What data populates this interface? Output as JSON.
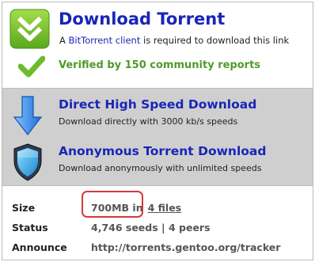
{
  "header": {
    "title": "Download Torrent",
    "subtitle_prefix": "A ",
    "client_link": "BitTorrent client",
    "subtitle_suffix": " is required to download this link",
    "verified": "Verified by 150 community reports"
  },
  "offers": [
    {
      "title": "Direct High Speed Download",
      "subtitle": "Download directly with 3000 kb/s speeds",
      "icon": "down-arrow-icon"
    },
    {
      "title": "Anonymous Torrent Download",
      "subtitle": "Download anonymously with unlimited speeds",
      "icon": "shield-icon"
    }
  ],
  "details": {
    "size_label": "Size",
    "size_value": "700MB in",
    "files_link": "4 files",
    "status_label": "Status",
    "seeds": "4,746 seeds",
    "status_sep": " | ",
    "peers": "4 peers",
    "announce_label": "Announce",
    "announce_value": "http://torrents.gentoo.org/tracker"
  },
  "colors": {
    "accent_blue": "#1a25b8",
    "verified_green": "#4f9a2a",
    "band_grey": "#cfcfcf",
    "highlight_red": "#d23a3a"
  }
}
